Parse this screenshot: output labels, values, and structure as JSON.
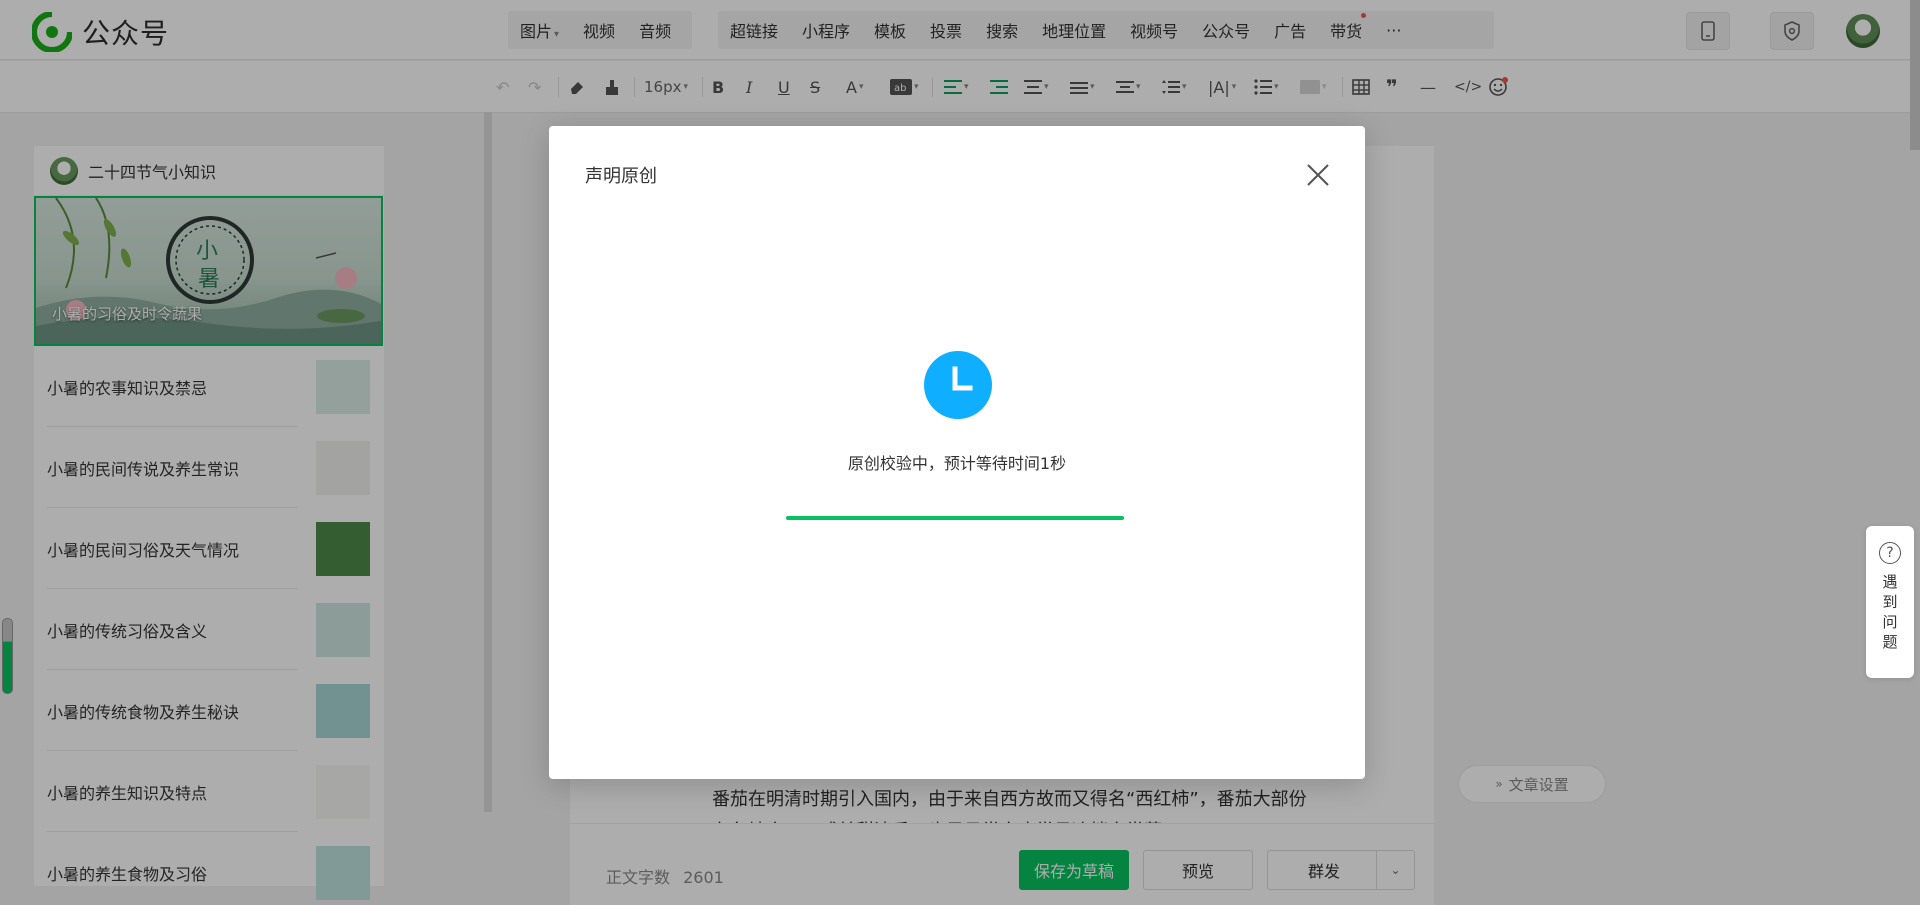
{
  "header": {
    "brand": "公众号",
    "nav_media": [
      {
        "label": "图片",
        "caret": true
      },
      {
        "label": "视频",
        "caret": false
      },
      {
        "label": "音频",
        "caret": false
      }
    ],
    "nav_insert": [
      {
        "label": "超链接",
        "dot": false
      },
      {
        "label": "小程序",
        "dot": false
      },
      {
        "label": "模板",
        "dot": false
      },
      {
        "label": "投票",
        "dot": false
      },
      {
        "label": "搜索",
        "dot": false
      },
      {
        "label": "地理位置",
        "dot": false
      },
      {
        "label": "视频号",
        "dot": false
      },
      {
        "label": "公众号",
        "dot": false
      },
      {
        "label": "广告",
        "dot": false
      },
      {
        "label": "带货",
        "dot": true
      }
    ],
    "more_glyph": "···"
  },
  "toolbar": {
    "font_size": "16px"
  },
  "left_panel": {
    "account_name": "二十四节气小知识",
    "cover_title": "小暑的习俗及时令蔬果",
    "articles": [
      {
        "title": "小暑的农事知识及禁忌",
        "thumb_color": "#d9ece6"
      },
      {
        "title": "小暑的民间传说及养生常识",
        "thumb_color": "#f1f1ee"
      },
      {
        "title": "小暑的民间习俗及天气情况",
        "thumb_color": "#4f8a4a"
      },
      {
        "title": "小暑的传统习俗及含义",
        "thumb_color": "#cfe6e1"
      },
      {
        "title": "小暑的传统食物及养生秘诀",
        "thumb_color": "#a9d7d8"
      },
      {
        "title": "小暑的养生知识及特点",
        "thumb_color": "#f7f6f3"
      },
      {
        "title": "小暑的养生食物及习俗",
        "thumb_color": "#bfe2df"
      }
    ]
  },
  "editor": {
    "body_text": "番茄在明清时期引入国内，由于来自西方故而又得名“西红柿”，番茄大部份在各地方，口感甘甜清香，也是日常家庭常见凉拌家常菜……"
  },
  "bottom_bar": {
    "word_count_label": "正文字数",
    "word_count": "2601",
    "save_draft": "保存为草稿",
    "preview": "预览",
    "publish": "群发"
  },
  "side": {
    "article_settings": "文章设置",
    "help_label": "遇到问题"
  },
  "modal": {
    "title": "声明原创",
    "status": "原创校验中，预计等待时间1秒",
    "progress": 1.0
  },
  "colors": {
    "accent": "#07c160",
    "clock_blue": "#10aeff"
  }
}
